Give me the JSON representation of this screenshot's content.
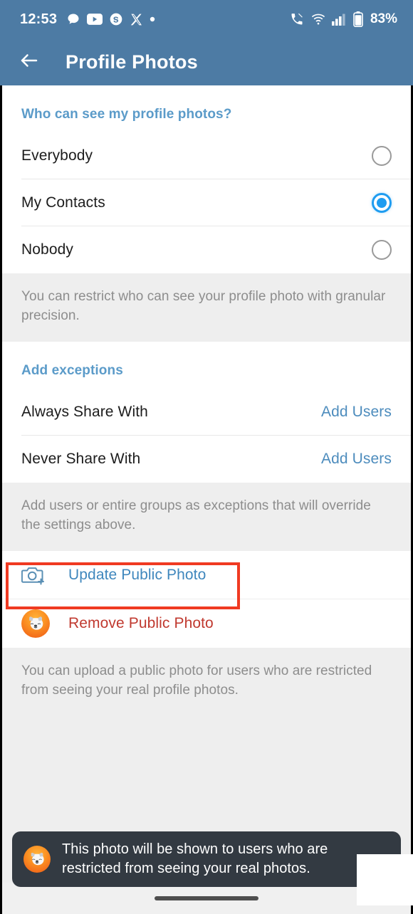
{
  "statusbar": {
    "time": "12:53",
    "battery_percent": "83%",
    "left_icons": [
      "chat-bubble-icon",
      "youtube-icon",
      "skype-icon",
      "x-twitter-icon",
      "dot-icon"
    ],
    "right_icons": [
      "phone-signal-icon",
      "wifi-icon",
      "cellular-signal-icon",
      "battery-icon"
    ]
  },
  "toolbar": {
    "back_icon": "back-arrow-icon",
    "title": "Profile Photos"
  },
  "visibility": {
    "section_title": "Who can see my profile photos?",
    "options": [
      {
        "label": "Everybody",
        "selected": false
      },
      {
        "label": "My Contacts",
        "selected": true
      },
      {
        "label": "Nobody",
        "selected": false
      }
    ],
    "note": "You can restrict who can see your profile photo with granular precision."
  },
  "exceptions": {
    "section_title": "Add exceptions",
    "rows": [
      {
        "label": "Always Share With",
        "action": "Add Users"
      },
      {
        "label": "Never Share With",
        "action": "Add Users"
      }
    ],
    "note": "Add users or entire groups as exceptions that will override the settings above."
  },
  "public_photo": {
    "update_label": "Update Public Photo",
    "update_icon": "camera-add-icon",
    "remove_label": "Remove Public Photo",
    "remove_icon": "public-photo-avatar",
    "note": "You can upload a public photo for users who are restricted from seeing your real profile photos.",
    "highlighted_row": "Remove Public Photo"
  },
  "toast": {
    "icon": "public-photo-avatar",
    "message": "This photo will be shown to users who are restricted from seeing your real photos."
  },
  "colors": {
    "toolbar": "#4d7ba4",
    "accent_blue": "#4d8cbd",
    "section_blue": "#5b9bc9",
    "radio_selected": "#1e9cf0",
    "destructive_red": "#c0392f",
    "highlight_red": "#f03a22",
    "page_background": "#eeeeee",
    "toast_background": "#333a42"
  }
}
